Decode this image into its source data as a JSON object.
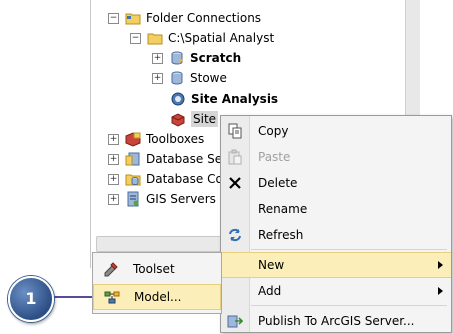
{
  "tree": {
    "items": [
      {
        "label": "Folder Connections",
        "expander": "⊟",
        "icon": "folder-connections-icon"
      },
      {
        "label": "C:\\Spatial Analyst",
        "expander": "⊟",
        "icon": "folder-icon"
      },
      {
        "label": "Scratch",
        "expander": "⊞",
        "icon": "geodatabase-icon"
      },
      {
        "label": "Stowe",
        "expander": "⊞",
        "icon": "geodatabase-icon"
      },
      {
        "label": "Site Analysis",
        "icon": "toolbox-icon"
      },
      {
        "label": "Site",
        "icon": "toolbox-icon"
      },
      {
        "label": "Toolboxes",
        "expander": "⊞",
        "icon": "toolboxes-icon"
      },
      {
        "label": "Database Se",
        "expander": "⊞",
        "icon": "database-servers-icon"
      },
      {
        "label": "Database Co",
        "expander": "⊞",
        "icon": "database-connections-icon"
      },
      {
        "label": "GIS Servers",
        "expander": "⊞",
        "icon": "gis-servers-icon"
      }
    ]
  },
  "context_menu": {
    "items": [
      {
        "label": "Copy",
        "icon": "copy-icon",
        "enabled": true
      },
      {
        "label": "Paste",
        "icon": "paste-icon",
        "enabled": false
      },
      {
        "label": "Delete",
        "icon": "delete-icon",
        "enabled": true
      },
      {
        "label": "Rename",
        "enabled": true
      },
      {
        "label": "Refresh",
        "icon": "refresh-icon",
        "enabled": true
      },
      {
        "label": "New",
        "enabled": true,
        "highlighted": true,
        "submenu": true
      },
      {
        "label": "Add",
        "enabled": true,
        "submenu": true
      },
      {
        "label": "Publish To ArcGIS Server...",
        "icon": "publish-icon",
        "enabled": true
      }
    ]
  },
  "new_submenu": {
    "items": [
      {
        "label": "Toolset",
        "icon": "toolset-icon"
      },
      {
        "label": "Model...",
        "icon": "model-icon",
        "highlighted": true
      }
    ]
  },
  "callout": {
    "number": "1"
  },
  "colors": {
    "highlight": "#fbeeb8",
    "callout": "#2c4f86"
  }
}
